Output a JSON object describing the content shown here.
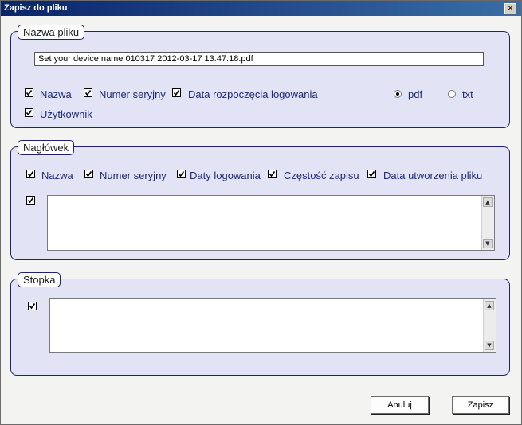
{
  "window": {
    "title": "Zapisz do pliku",
    "close_symbol": "×"
  },
  "file_name_group": {
    "legend": "Nazwa pliku",
    "file_name_value": "Set your device name 010317 2012-03-17 13.47.18.pdf",
    "options": [
      {
        "label": "Nazwa",
        "checked": true
      },
      {
        "label": "Numer seryjny",
        "checked": true
      },
      {
        "label": "Data rozpoczęcia logowania",
        "checked": true
      },
      {
        "label": "Użytkownik",
        "checked": true
      }
    ],
    "formats": [
      {
        "label": "pdf",
        "selected": true
      },
      {
        "label": "txt",
        "selected": false
      }
    ]
  },
  "header_group": {
    "legend": "Nagłówek",
    "options": [
      {
        "label": "Nazwa",
        "checked": true
      },
      {
        "label": "Numer seryjny",
        "checked": true
      },
      {
        "label": "Daty logowania",
        "checked": true
      },
      {
        "label": "Częstość zapisu",
        "checked": true
      },
      {
        "label": "Data utworzenia pliku",
        "checked": true
      }
    ],
    "custom_text_checked": true,
    "custom_text": ""
  },
  "footer_group": {
    "legend": "Stopka",
    "custom_text_checked": true,
    "custom_text": ""
  },
  "buttons": {
    "cancel": "Anuluj",
    "save": "Zapisz"
  },
  "colors": {
    "titlebar_start": "#0a246a",
    "titlebar_end": "#3a6ea5",
    "group_fill": "#e3e3f6",
    "group_border": "#1e2472",
    "label_text": "#1c2a78"
  }
}
